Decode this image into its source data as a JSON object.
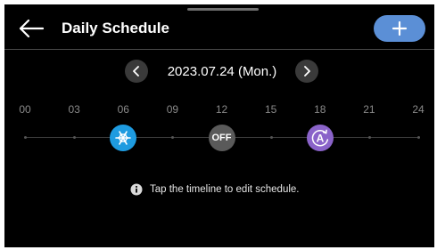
{
  "header": {
    "title": "Daily Schedule",
    "back_icon": "arrow-left-icon",
    "add_icon": "plus-icon",
    "add_color": "#5b8fd6"
  },
  "date_nav": {
    "prev_icon": "chevron-left-icon",
    "next_icon": "chevron-right-icon",
    "date": "2023.07.24 (Mon.)"
  },
  "timeline": {
    "ticks": [
      "00",
      "03",
      "06",
      "09",
      "12",
      "15",
      "18",
      "21",
      "24"
    ],
    "events": [
      {
        "hour": 6,
        "mode": "cool",
        "icon": "snowflake-icon",
        "color": "#1e9be0"
      },
      {
        "hour": 12,
        "mode": "off",
        "label": "OFF",
        "color": "#5a5a5a"
      },
      {
        "hour": 18,
        "mode": "auto",
        "icon": "auto-mode-icon",
        "label": "A",
        "color": "#8a63c9"
      }
    ]
  },
  "hint": {
    "icon": "info-icon",
    "text": "Tap the timeline to edit schedule."
  }
}
